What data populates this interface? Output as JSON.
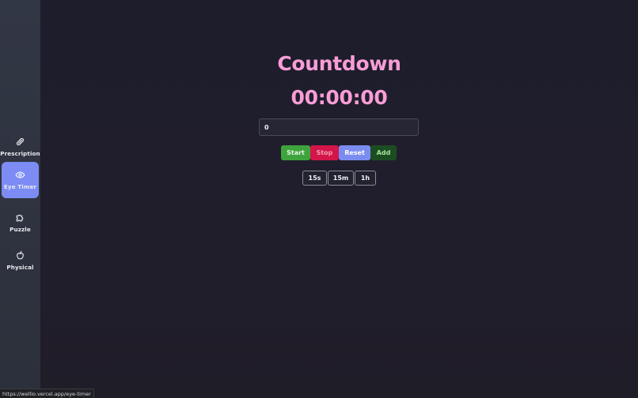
{
  "sidebar": {
    "items": [
      {
        "label": "Prescription",
        "icon": "pill-icon"
      },
      {
        "label": "Eye Timer",
        "icon": "eye-icon",
        "active": true
      },
      {
        "label": "Puzzle",
        "icon": "puzzle-icon"
      },
      {
        "label": "Physical",
        "icon": "apple-icon"
      }
    ]
  },
  "main": {
    "title": "Countdown",
    "clock": "00:00:00",
    "input": {
      "value": "0"
    },
    "buttons": {
      "start": "Start",
      "stop": "Stop",
      "reset": "Reset",
      "add": "Add"
    },
    "presets": [
      "15s",
      "15m",
      "1h"
    ]
  },
  "status_bar": {
    "url": "https://wellio.vercel.app/eye-timer"
  },
  "colors": {
    "accent": "#7c8cf4",
    "title_pink": "#f79dd6",
    "start_green": "#3ea33c",
    "stop_red": "#d3154a",
    "add_green": "#1c4d22"
  }
}
